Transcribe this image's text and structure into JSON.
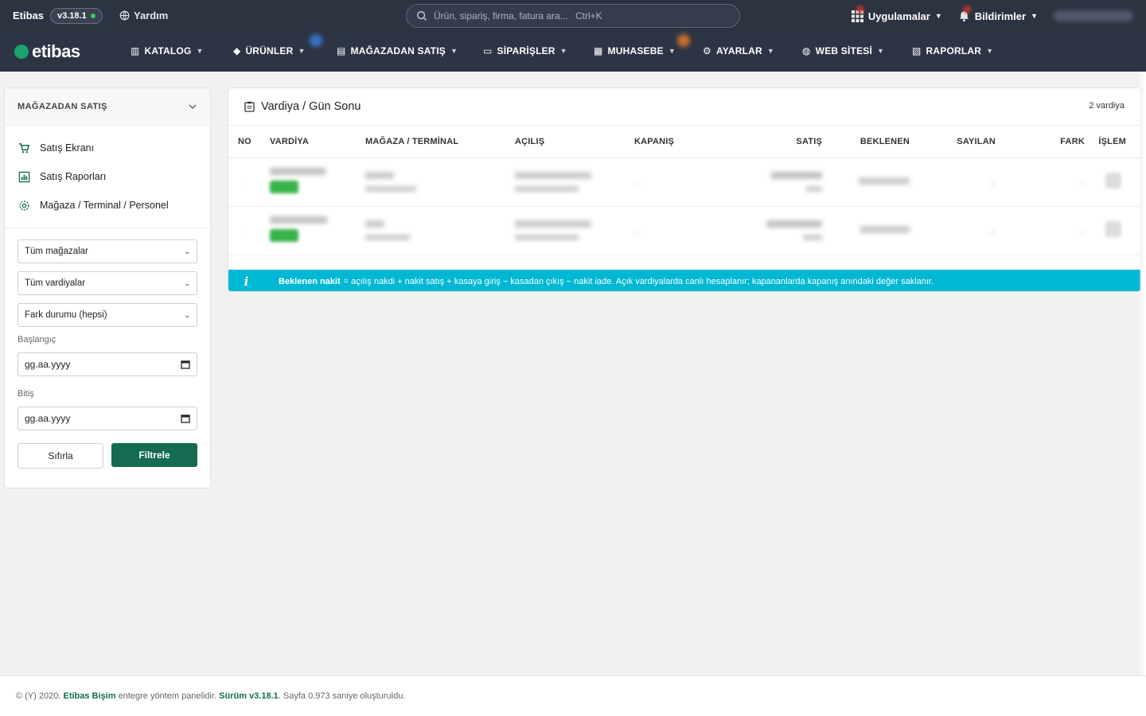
{
  "topbar": {
    "brand": "Etibas",
    "version": "v3.18.1",
    "help": "Yardım",
    "search_placeholder": "Ürün, sipariş, firma, fatura ara...",
    "search_shortcut": "Ctrl+K",
    "apps": "Uygulamalar",
    "notifications": "Bildirimler"
  },
  "nav": {
    "logo": "etibas",
    "items": [
      "KATALOG",
      "ÜRÜNLER",
      "MAĞAZADAN SATIŞ",
      "SİPARİŞLER",
      "MUHASEBE",
      "AYARLAR",
      "WEB SİTESİ",
      "RAPORLAR"
    ]
  },
  "sidebar": {
    "title": "MAĞAZADAN SATIŞ",
    "links": [
      "Satış Ekranı",
      "Satış Raporları",
      "Mağaza / Terminal / Personel"
    ],
    "store_select": "Tüm mağazalar",
    "shift_select": "Tüm vardiyalar",
    "diff_select": "Fark durumu (hepsi)",
    "start_label": "Başlangıç",
    "start_placeholder": "gg.aa.yyyy",
    "end_label": "Bitiş",
    "end_placeholder": "gg.aa.yyyy",
    "reset": "Sıfırla",
    "filter": "Filtrele"
  },
  "main": {
    "title": "Vardiya / Gün Sonu",
    "count": "2 vardiya",
    "columns": [
      "NO",
      "VARDİYA",
      "MAĞAZA / TERMİNAL",
      "AÇILIŞ",
      "KAPANIŞ",
      "SATIŞ",
      "BEKLENEN",
      "SAYILAN",
      "FARK",
      "İŞLEM"
    ],
    "info_bold": "Beklenen nakit",
    "info_text": "= açılış nakdi + nakit satış + kasaya giriş − kasadan çıkış − nakit iade. Açık vardiyalarda canlı hesaplanır; kapananlarda kapanış anındaki değer saklanır."
  },
  "footer": {
    "prefix": "© (Y) 2020.",
    "company": "Etibas Bişim",
    "middle": "entegre yöntem panelidir.",
    "version": "Sürüm v3.18.1",
    "suffix": ". Sayfa 0.973 saniye oluşturuldu."
  },
  "colors": {
    "topbar": "#2c3341",
    "accent": "#146b51",
    "info": "#00b8d4",
    "status_green": "#38b24a"
  }
}
